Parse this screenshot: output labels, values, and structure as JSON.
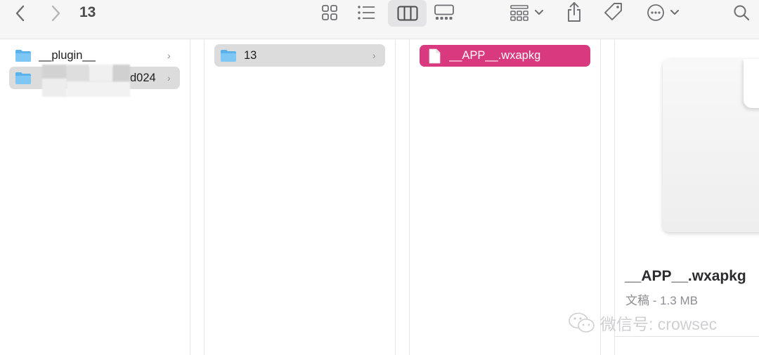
{
  "window": {
    "title": "13"
  },
  "toolbar": {
    "back_icon": "chevron-left-icon",
    "forward_icon": "chevron-right-icon",
    "view_modes": [
      "icon-view",
      "list-view",
      "column-view",
      "gallery-view"
    ],
    "active_view": "column-view"
  },
  "columns": [
    {
      "items": [
        {
          "label": "__plugin__",
          "icon": "folder-icon",
          "state": "normal"
        },
        {
          "label": "d024",
          "icon": "folder-icon",
          "state": "path"
        }
      ]
    },
    {
      "items": [
        {
          "label": "13",
          "icon": "folder-icon",
          "state": "path"
        }
      ]
    },
    {
      "items": [
        {
          "label": "__APP__.wxapkg",
          "icon": "document-icon",
          "state": "selected"
        }
      ]
    }
  ],
  "preview": {
    "filename": "__APP__.wxapkg",
    "meta": "文稿 - 1.3 MB"
  },
  "watermark": {
    "text": "微信号: crowsec"
  },
  "colors": {
    "selection": "#d9397e",
    "path_highlight": "#dcdcdc",
    "folder": "#5ab2ea"
  }
}
